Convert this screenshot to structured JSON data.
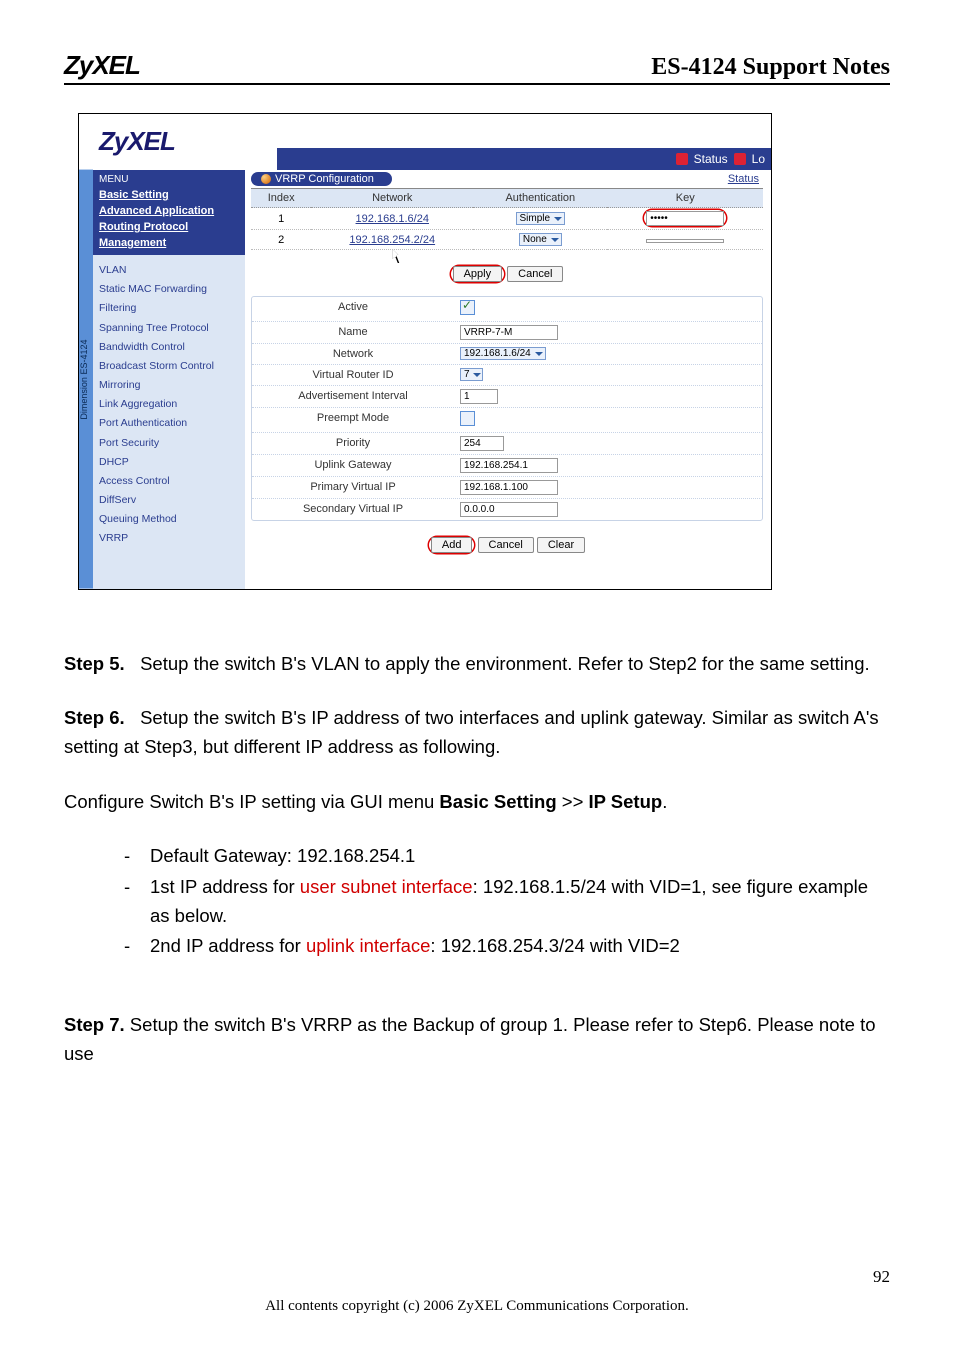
{
  "header": {
    "logo": "ZyXEL",
    "title": "ES-4124 Support Notes"
  },
  "screenshot": {
    "logo": "ZyXEL",
    "status_bar": {
      "status": "Status",
      "log": "Lo"
    },
    "side_tab": "Dimension ES-4124",
    "menu_header": "MENU",
    "main_menu": [
      "Basic Setting",
      "Advanced Application",
      "Routing Protocol",
      "Management"
    ],
    "sub_menu": [
      "VLAN",
      "Static MAC Forwarding",
      "Filtering",
      "Spanning Tree Protocol",
      "Bandwidth Control",
      "Broadcast Storm Control",
      "Mirroring",
      "Link Aggregation",
      "Port Authentication",
      "Port Security",
      "DHCP",
      "Access Control",
      "DiffServ",
      "Queuing Method",
      "VRRP"
    ],
    "vrrp_title": "VRRP Configuration",
    "status_link": "Status",
    "table": {
      "headers": [
        "Index",
        "Network",
        "Authentication",
        "Key"
      ],
      "rows": [
        {
          "index": "1",
          "network": "192.168.1.6/24",
          "auth": "Simple",
          "key": "•••••"
        },
        {
          "index": "2",
          "network": "192.168.254.2/24",
          "auth": "None",
          "key": ""
        }
      ]
    },
    "apply_btn": "Apply",
    "cancel_btn": "Cancel",
    "form": [
      {
        "label": "Active",
        "type": "checkbox",
        "checked": true
      },
      {
        "label": "Name",
        "type": "text",
        "value": "VRRP-7-M"
      },
      {
        "label": "Network",
        "type": "select",
        "value": "192.168.1.6/24"
      },
      {
        "label": "Virtual Router ID",
        "type": "miniselect",
        "value": "7"
      },
      {
        "label": "Advertisement Interval",
        "type": "text",
        "value": "1"
      },
      {
        "label": "Preempt Mode",
        "type": "checkbox",
        "checked": false
      },
      {
        "label": "Priority",
        "type": "text",
        "value": "254"
      },
      {
        "label": "Uplink Gateway",
        "type": "text",
        "value": "192.168.254.1"
      },
      {
        "label": "Primary Virtual IP",
        "type": "text",
        "value": "192.168.1.100"
      },
      {
        "label": "Secondary Virtual IP",
        "type": "text",
        "value": "0.0.0.0"
      }
    ],
    "bottom_buttons": {
      "add": "Add",
      "cancel": "Cancel",
      "clear": "Clear"
    }
  },
  "steps": {
    "s5_label": "Step 5.",
    "s5_text": "Setup the switch B's VLAN to apply the environment. Refer to Step2 for the same setting.",
    "s6_label": "Step 6.",
    "s6_text": "Setup the switch B's IP address of two interfaces and uplink gateway. Similar as switch A's setting at Step3, but different IP address as following.",
    "s6_cfg_pre": "Configure Switch B's IP setting via GUI menu ",
    "s6_cfg_bold1": "Basic Setting",
    "s6_cfg_mid": " >> ",
    "s6_cfg_bold2": "IP Setup",
    "s6_cfg_post": ".",
    "bullets": {
      "b1": "Default Gateway: 192.168.254.1",
      "b2_pre": "1st IP address for ",
      "b2_red": "user subnet interface",
      "b2_post": ": 192.168.1.5/24 with VID=1, see figure example as below.",
      "b3_pre": "2nd IP address for ",
      "b3_red": "uplink interface",
      "b3_post": ": 192.168.254.3/24 with VID=2"
    },
    "s7_label": "Step 7.",
    "s7_text": " Setup the switch B's VRRP as the Backup of group 1. Please refer to Step6. Please note to use"
  },
  "footer": {
    "copyright": "All contents copyright (c) 2006 ZyXEL Communications Corporation.",
    "page_number": "92"
  }
}
